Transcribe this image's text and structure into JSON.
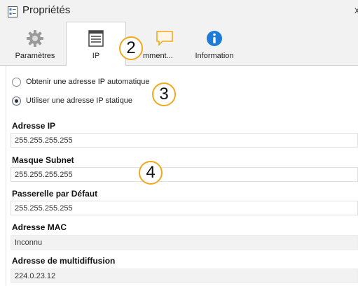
{
  "window": {
    "title": "Propriétés",
    "close": "x"
  },
  "tabs": [
    {
      "label": "Paramètres",
      "icon": "gear-icon"
    },
    {
      "label": "IP",
      "icon": "ip-list-icon"
    },
    {
      "label": "Commentaires",
      "label_visible": "mment...",
      "icon": "comment-icon"
    },
    {
      "label": "Information",
      "icon": "info-icon"
    }
  ],
  "ip_mode": {
    "auto_label": "Obtenir une adresse IP automatique",
    "static_label": "Utiliser une adresse IP statique",
    "selected": "static"
  },
  "fields": {
    "ip": {
      "label": "Adresse IP",
      "value": "255.255.255.255"
    },
    "subnet": {
      "label": "Masque Subnet",
      "value": "255.255.255.255"
    },
    "gateway": {
      "label": "Passerelle par Défaut",
      "value": "255.255.255.255"
    },
    "mac": {
      "label": "Adresse MAC",
      "value": "Inconnu"
    },
    "multicast": {
      "label": "Adresse de multidiffusion",
      "value": "224.0.23.12"
    }
  },
  "callouts": [
    "2",
    "3",
    "4"
  ],
  "colors": {
    "callout_border": "#f0a81c",
    "info_blue": "#1e7bd6",
    "comment_orange": "#f0a81c"
  }
}
